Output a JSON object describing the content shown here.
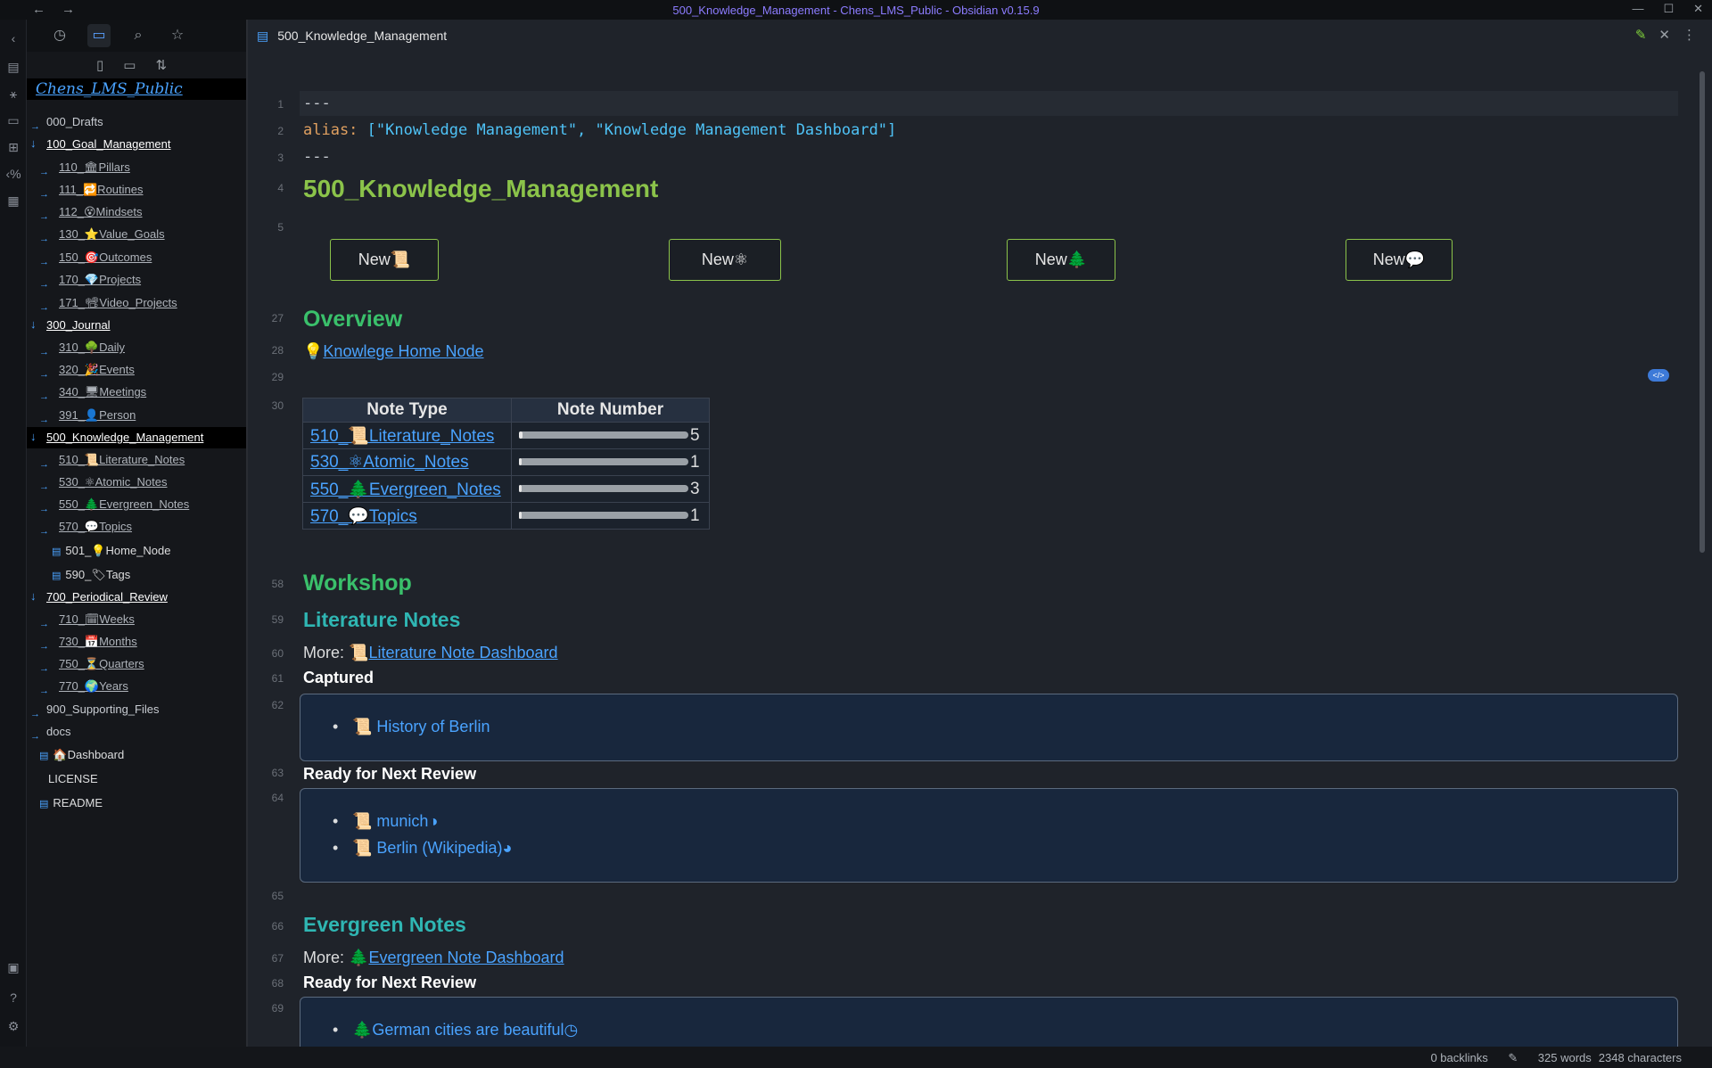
{
  "window": {
    "title": "500_Knowledge_Management - Chens_LMS_Public - Obsidian v0.15.9",
    "back": "←",
    "forward": "→",
    "controls": [
      "—",
      "☐",
      "✕"
    ]
  },
  "ribbon": {
    "icons": [
      "chevron-left-icon",
      "open-quick-switcher-icon",
      "graph-view-icon",
      "canvas-icon",
      "tables-icon",
      "templater-icon",
      "calendar-icon",
      "vault-switcher-icon",
      "help-icon",
      "settings-icon"
    ]
  },
  "sidebar": {
    "tabs": [
      "recent-files",
      "file-explorer",
      "search",
      "bookmarks"
    ],
    "tools": [
      "new-note",
      "new-folder",
      "sort"
    ],
    "vault_name": "Chens_LMS_Public",
    "tree": [
      {
        "label": "000_Drafts",
        "type": "folder",
        "expanded": false
      },
      {
        "label": "100_Goal_Management",
        "type": "folder",
        "expanded": true
      },
      {
        "label": "110_🏛Pillars",
        "type": "subfolder"
      },
      {
        "label": "111_🔁Routines",
        "type": "subfolder"
      },
      {
        "label": "112_😵Mindsets",
        "type": "subfolder"
      },
      {
        "label": "130_⭐Value_Goals",
        "type": "subfolder"
      },
      {
        "label": "150_🎯Outcomes",
        "type": "subfolder"
      },
      {
        "label": "170_💎Projects",
        "type": "subfolder"
      },
      {
        "label": "171_📽Video_Projects",
        "type": "subfolder"
      },
      {
        "label": "300_Journal",
        "type": "folder",
        "expanded": true
      },
      {
        "label": "310_🌳Daily",
        "type": "subfolder"
      },
      {
        "label": "320_🎉Events",
        "type": "subfolder"
      },
      {
        "label": "340_🖥Meetings",
        "type": "subfolder"
      },
      {
        "label": "391_👤Person",
        "type": "subfolder"
      },
      {
        "label": "500_Knowledge_Management",
        "type": "folder",
        "expanded": true
      },
      {
        "label": "510_📜Literature_Notes",
        "type": "subfolder"
      },
      {
        "label": "530_⚛Atomic_Notes",
        "type": "subfolder"
      },
      {
        "label": "550_🌲Evergreen_Notes",
        "type": "subfolder"
      },
      {
        "label": "570_💬Topics",
        "type": "subfolder"
      },
      {
        "label": "501_💡Home_Node",
        "type": "file"
      },
      {
        "label": "590_🏷Tags",
        "type": "file"
      },
      {
        "label": "700_Periodical_Review",
        "type": "folder",
        "expanded": true
      },
      {
        "label": "710_🗓Weeks",
        "type": "subfolder"
      },
      {
        "label": "730_📅Months",
        "type": "subfolder"
      },
      {
        "label": "750_⏳Quarters",
        "type": "subfolder"
      },
      {
        "label": "770_🌍Years",
        "type": "subfolder"
      },
      {
        "label": "900_Supporting_Files",
        "type": "folder",
        "expanded": false
      },
      {
        "label": "docs",
        "type": "folder",
        "expanded": false
      },
      {
        "label": "🏠Dashboard",
        "type": "file"
      },
      {
        "label": "LICENSE",
        "type": "plain"
      },
      {
        "label": "README",
        "type": "file"
      }
    ]
  },
  "tab": {
    "title": "500_Knowledge_Management"
  },
  "editor": {
    "frontmatter": {
      "dashes": "---",
      "alias_key": "alias:",
      "alias_value": " [\"Knowledge Management\", \"Knowledge Management Dashboard\"]"
    },
    "heading": "500_Knowledge_Management",
    "buttons": [
      "New📜",
      "New⚛",
      "New🌲",
      "New💬"
    ],
    "overview_heading": "Overview",
    "home_link": "Knowlege Home Node",
    "home_icon": "💡",
    "table": {
      "headers": [
        "Note Type",
        "Note Number"
      ],
      "rows": [
        {
          "prefix": "510_",
          "icon": "📜",
          "name": "Literature_Notes",
          "count": "5",
          "fill": 0.02
        },
        {
          "prefix": "530_",
          "icon": "⚛",
          "name": "Atomic_Notes",
          "count": "1",
          "fill": 0.01
        },
        {
          "prefix": "550_",
          "icon": "🌲",
          "name": "Evergreen_Notes",
          "count": "3",
          "fill": 0.01
        },
        {
          "prefix": "570_",
          "icon": "💬",
          "name": "Topics",
          "count": "1",
          "fill": 0.01
        }
      ]
    },
    "workshop_heading": "Workshop",
    "lit_heading": "Literature Notes",
    "lit_more_label": "More: ",
    "lit_more_icon": "📜",
    "lit_more_link": "Literature Note Dashboard",
    "captured_label": "Captured",
    "captured_items": [
      "📜 History of Berlin"
    ],
    "lit_review_label": "Ready for Next Review",
    "lit_review_items": [
      "📜 munich◑",
      "📜 Berlin (Wikipedia)◕"
    ],
    "ever_heading": "Evergreen Notes",
    "ever_more_label": "More: ",
    "ever_more_icon": "🌲",
    "ever_more_link": "Evergreen Note Dashboard",
    "ever_review_label": "Ready for Next Review",
    "ever_review_items": [
      "🌲German cities are beautiful◷"
    ],
    "line_numbers": [
      "1",
      "2",
      "3",
      "4",
      "5",
      "27",
      "28",
      "29",
      "30",
      "58",
      "59",
      "60",
      "61",
      "62",
      "63",
      "64",
      "65",
      "66",
      "67",
      "68",
      "69"
    ],
    "code_chip": "</>"
  },
  "status": {
    "backlinks": "0 backlinks",
    "words": "325 words",
    "chars": "2348 characters"
  },
  "colors": {
    "accent": "#4aa3ff",
    "heading_green": "#8bc34a",
    "heading_teal": "#2fb6b3"
  }
}
